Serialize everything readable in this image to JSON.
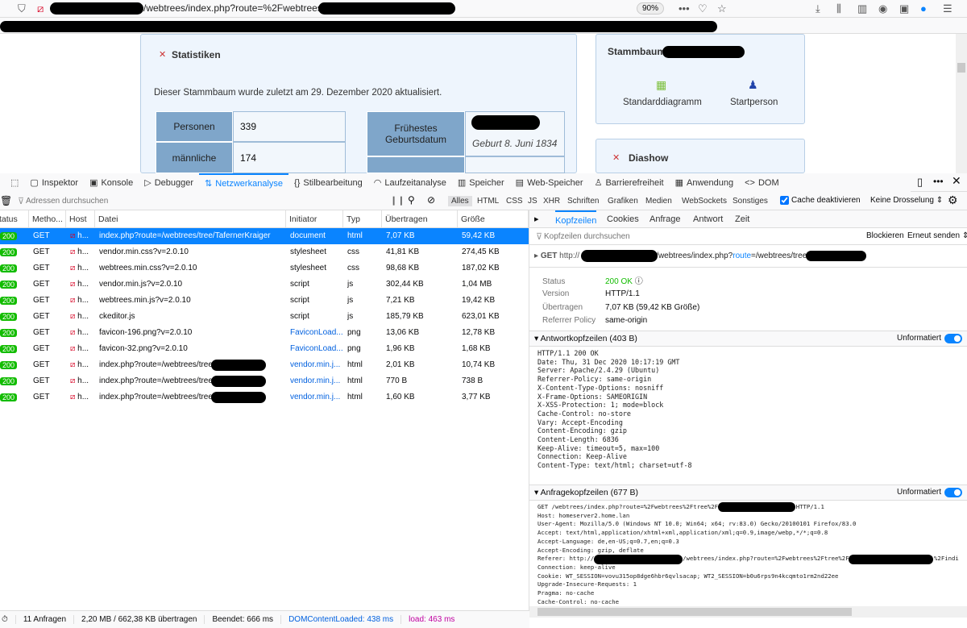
{
  "browser": {
    "url": "/webtrees/index.php?route=%2Fwebtrees%2Ftree%2F",
    "zoom": "90%"
  },
  "page": {
    "stats": {
      "title": "Statistiken",
      "updated": "Dieser Stammbaum wurde zuletzt am 29. Dezember 2020 aktualisiert.",
      "rows": [
        {
          "label": "Personen",
          "value": "339"
        },
        {
          "label": "männliche",
          "value": "174"
        }
      ],
      "earliest_label": "Frühestes Geburtsdatum",
      "earliest_value": "Geburt 8. Juni 1834"
    },
    "tree": {
      "title": "Stammbaum",
      "links": [
        "Standarddiagramm",
        "Startperson"
      ]
    },
    "slideshow": {
      "title": "Diashow"
    }
  },
  "devtools": {
    "tabs": [
      "Inspektor",
      "Konsole",
      "Debugger",
      "Netzwerkanalyse",
      "Stilbearbeitung",
      "Laufzeitanalyse",
      "Speicher",
      "Web-Speicher",
      "Barrierefreiheit",
      "Anwendung",
      "DOM"
    ],
    "tab_icons": [
      "▢",
      "▣",
      "▷",
      "⇅",
      "{}",
      "◠",
      "▥",
      "▤",
      "♙",
      "▦",
      "<>"
    ],
    "filter_placeholder": "Adressen durchsuchen",
    "types": [
      "Alles",
      "HTML",
      "CSS",
      "JS",
      "XHR",
      "Schriften",
      "Grafiken",
      "Medien",
      "WebSockets",
      "Sonstiges"
    ],
    "cache": "Cache deaktivieren",
    "throttle": "Keine Drosselung ⇕",
    "columns": [
      "Status",
      "Metho...",
      "Host",
      "Datei",
      "Initiator",
      "Typ",
      "Übertragen",
      "Größe"
    ],
    "requests": [
      {
        "status": "200",
        "method": "GET",
        "host": "h...",
        "file": "index.php?route=/webtrees/tree/TafernerKraiger",
        "initiator": "document",
        "type": "html",
        "transferred": "7,07 KB",
        "size": "59,42 KB"
      },
      {
        "status": "200",
        "method": "GET",
        "host": "h...",
        "file": "vendor.min.css?v=2.0.10",
        "initiator": "stylesheet",
        "type": "css",
        "transferred": "41,81 KB",
        "size": "274,45 KB"
      },
      {
        "status": "200",
        "method": "GET",
        "host": "h...",
        "file": "webtrees.min.css?v=2.0.10",
        "initiator": "stylesheet",
        "type": "css",
        "transferred": "98,68 KB",
        "size": "187,02 KB"
      },
      {
        "status": "200",
        "method": "GET",
        "host": "h...",
        "file": "vendor.min.js?v=2.0.10",
        "initiator": "script",
        "type": "js",
        "transferred": "302,44 KB",
        "size": "1,04 MB"
      },
      {
        "status": "200",
        "method": "GET",
        "host": "h...",
        "file": "webtrees.min.js?v=2.0.10",
        "initiator": "script",
        "type": "js",
        "transferred": "7,21 KB",
        "size": "19,42 KB"
      },
      {
        "status": "200",
        "method": "GET",
        "host": "h...",
        "file": "ckeditor.js",
        "initiator": "script",
        "type": "js",
        "transferred": "185,79 KB",
        "size": "623,01 KB"
      },
      {
        "status": "200",
        "method": "GET",
        "host": "h...",
        "file": "favicon-196.png?v=2.0.10",
        "initiator": "FaviconLoad...",
        "type": "png",
        "transferred": "13,06 KB",
        "size": "12,78 KB"
      },
      {
        "status": "200",
        "method": "GET",
        "host": "h...",
        "file": "favicon-32.png?v=2.0.10",
        "initiator": "FaviconLoad...",
        "type": "png",
        "transferred": "1,96 KB",
        "size": "1,68 KB"
      },
      {
        "status": "200",
        "method": "GET",
        "host": "h...",
        "file": "index.php?route=/webtrees/tree/                    /tree-",
        "initiator": "vendor.min.j...",
        "type": "html",
        "transferred": "2,01 KB",
        "size": "10,74 KB"
      },
      {
        "status": "200",
        "method": "GET",
        "host": "h...",
        "file": "index.php?route=/webtrees/tree                     /tree-",
        "initiator": "vendor.min.j...",
        "type": "html",
        "transferred": "770 B",
        "size": "738 B"
      },
      {
        "status": "200",
        "method": "GET",
        "host": "h...",
        "file": "index.php?route=/webtrees/tree                     /tree-",
        "initiator": "vendor.min.j...",
        "type": "html",
        "transferred": "1,60 KB",
        "size": "3,77 KB"
      }
    ],
    "summary": {
      "requests": "11 Anfragen",
      "transferred": "2,20 MB / 662,38 KB übertragen",
      "finished": "Beendet: 666 ms",
      "dcl": "DOMContentLoaded: 438 ms",
      "load": "load: 463 ms"
    },
    "panel": {
      "tabs": [
        "Kopfzeilen",
        "Cookies",
        "Anfrage",
        "Antwort",
        "Zeit"
      ],
      "filter_placeholder": "Kopfzeilen durchsuchen",
      "block": "Blockieren",
      "resend": "Erneut senden ⇕",
      "request_line": {
        "method": "GET",
        "prefix": "http://",
        "path": "/webtrees/index.php?",
        "param": "route",
        "rest": "=/webtrees/tree"
      },
      "status_label": "Status",
      "status_value": "200 OK",
      "version_label": "Version",
      "version_value": "HTTP/1.1",
      "transferred_label": "Übertragen",
      "transferred_value": "7,07 KB (59,42 KB Größe)",
      "referrer_label": "Referrer Policy",
      "referrer_value": "same-origin",
      "response_title": "Antwortkopfzeilen (403 B)",
      "raw_label": "Unformatiert",
      "response_raw": "HTTP/1.1 200 OK\nDate: Thu, 31 Dec 2020 10:17:19 GMT\nServer: Apache/2.4.29 (Ubuntu)\nReferrer-Policy: same-origin\nX-Content-Type-Options: nosniff\nX-Frame-Options: SAMEORIGIN\nX-XSS-Protection: 1; mode=block\nCache-Control: no-store\nVary: Accept-Encoding\nContent-Encoding: gzip\nContent-Length: 6836\nKeep-Alive: timeout=5, max=100\nConnection: Keep-Alive\nContent-Type: text/html; charset=utf-8",
      "request_title": "Anfragekopfzeilen (677 B)",
      "request_raw": "GET /webtrees/index.php?route=%2Fwebtrees%2Ftree%2F                      HTTP/1.1\nHost: homeserver2.home.lan\nUser-Agent: Mozilla/5.0 (Windows NT 10.0; Win64; x64; rv:83.0) Gecko/20100101 Firefox/83.0\nAccept: text/html,application/xhtml+xml,application/xml;q=0.9,image/webp,*/*;q=0.8\nAccept-Language: de,en-US;q=0.7,en;q=0.3\nAccept-Encoding: gzip, deflate\nReferer: http://                         /webtrees/index.php?route=%2Fwebtrees%2Ftree%2F                        %2Findi\nConnection: keep-alive\nCookie: WT_SESSION=vovu315op8dge6hbr6qvlsacap; WT2_SESSION=b0u6rps9n4kcqmto1rm2nd22ee\nUpgrade-Insecure-Requests: 1\nPragma: no-cache\nCache-Control: no-cache"
    }
  }
}
